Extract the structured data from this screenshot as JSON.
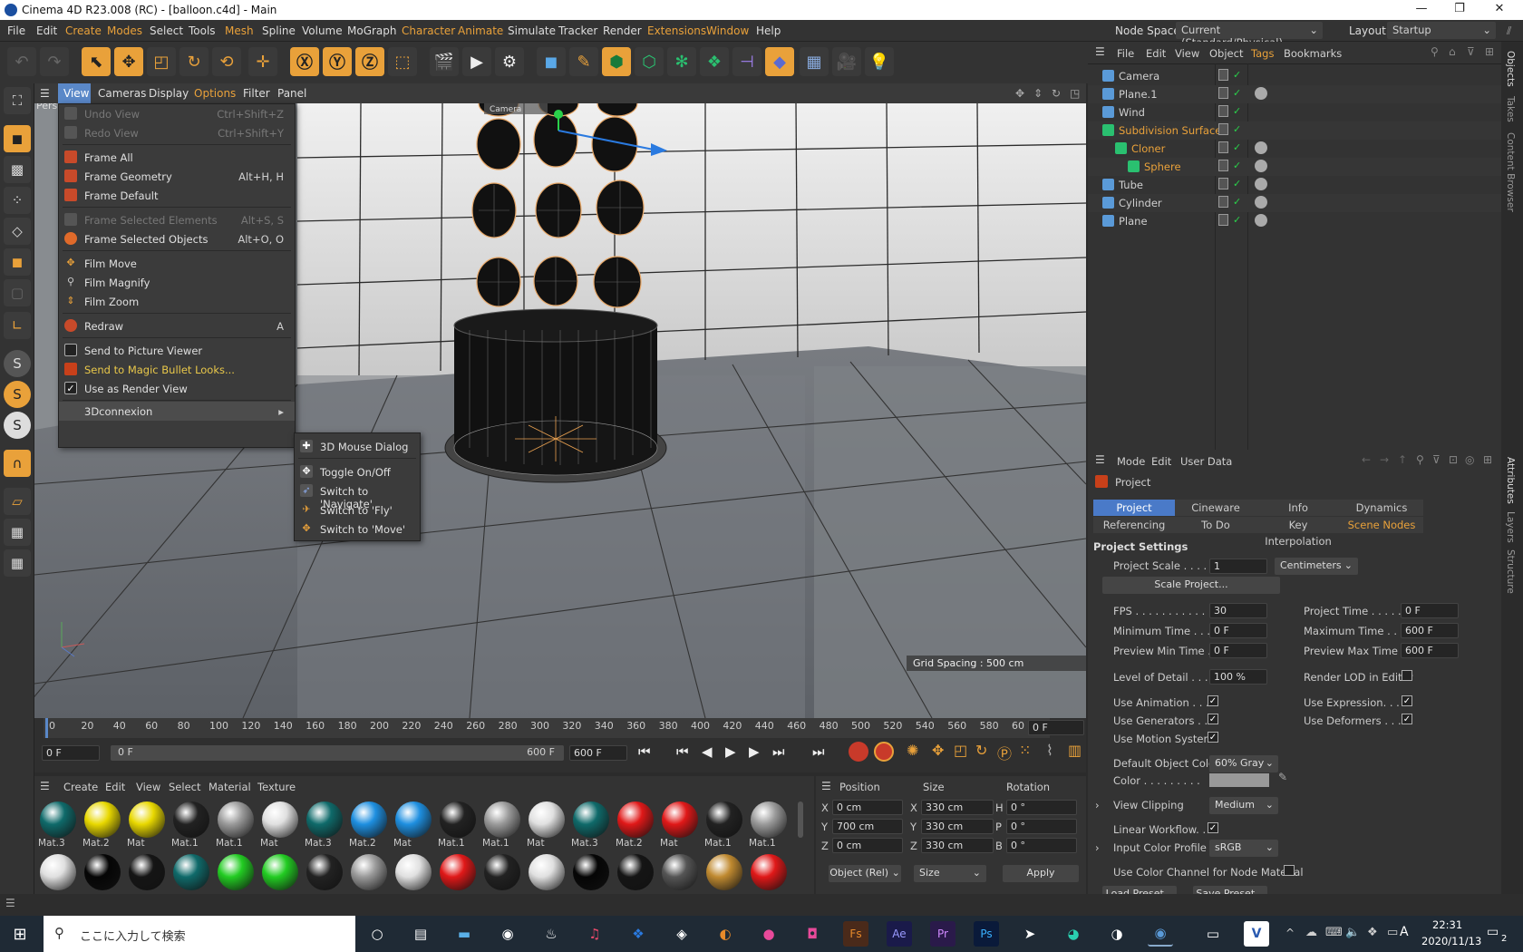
{
  "window": {
    "title": "Cinema 4D R23.008 (RC) - [balloon.c4d] - Main",
    "minimize": "—",
    "maximize": "❐",
    "close": "✕"
  },
  "menubar": {
    "items": [
      "File",
      "Edit",
      "Create",
      "Modes",
      "Select",
      "Tools",
      "Mesh",
      "Spline",
      "Volume",
      "MoGraph",
      "Character",
      "Animate",
      "Simulate",
      "Tracker",
      "Render",
      "Extensions",
      "Window",
      "Help"
    ],
    "nodespace_label": "Node Space:",
    "nodespace_value": "Current (Standard/Physical)",
    "layout_label": "Layout:",
    "layout_value": "Startup"
  },
  "viewport_menu": {
    "items": [
      "View",
      "Cameras",
      "Display",
      "Options",
      "Filter",
      "Panel"
    ],
    "persp": "Pers",
    "grid_spacing": "Grid Spacing : 500 cm",
    "camera_tag": "Camera"
  },
  "view_menu": {
    "undo_view": "Undo View",
    "undo_view_sc": "Ctrl+Shift+Z",
    "redo_view": "Redo View",
    "redo_view_sc": "Ctrl+Shift+Y",
    "frame_all": "Frame All",
    "frame_geometry": "Frame Geometry",
    "frame_geometry_sc": "Alt+H, H",
    "frame_default": "Frame Default",
    "frame_selected_elements": "Frame Selected Elements",
    "frame_selected_elements_sc": "Alt+S, S",
    "frame_selected_objects": "Frame Selected Objects",
    "frame_selected_objects_sc": "Alt+O, O",
    "film_move": "Film Move",
    "film_magnify": "Film Magnify",
    "film_zoom": "Film Zoom",
    "redraw": "Redraw",
    "redraw_sc": "A",
    "send_picture_viewer": "Send to Picture Viewer",
    "send_magic_bullet": "Send to Magic Bullet Looks...",
    "use_render_view": "Use as Render View",
    "connexion": "3Dconnexion"
  },
  "submenu": {
    "mouse_dialog": "3D Mouse Dialog",
    "toggle": "Toggle On/Off",
    "navigate": "Switch to 'Navigate'",
    "fly": "Switch to 'Fly'",
    "move": "Switch to 'Move'"
  },
  "timeline": {
    "ticks": [
      "0",
      "20",
      "40",
      "60",
      "80",
      "100",
      "120",
      "140",
      "160",
      "180",
      "200",
      "220",
      "240",
      "260",
      "280",
      "300",
      "320",
      "340",
      "360",
      "380",
      "400",
      "420",
      "440",
      "460",
      "480",
      "500",
      "520",
      "540",
      "560",
      "580",
      "60"
    ],
    "current_frame": "0 F",
    "start": "0 F",
    "range_start": "0 F",
    "range_end": "600 F",
    "end": "600 F",
    "right_frame": "0 F"
  },
  "material_manager": {
    "menu": [
      "Create",
      "Edit",
      "View",
      "Select",
      "Material",
      "Texture"
    ],
    "row1": [
      {
        "name": "Mat.3",
        "color": "#0f6a6a"
      },
      {
        "name": "Mat.2",
        "color": "#e8d800"
      },
      {
        "name": "Mat",
        "color": "#e8d800"
      },
      {
        "name": "Mat.1",
        "color": "#222222"
      },
      {
        "name": "Mat.1",
        "color": "#9a9a9a"
      },
      {
        "name": "Mat",
        "color": "#e0e0e0"
      },
      {
        "name": "Mat.3",
        "color": "#0f6a6a"
      },
      {
        "name": "Mat.2",
        "color": "#1e8fe0"
      },
      {
        "name": "Mat",
        "color": "#1e8fe0"
      },
      {
        "name": "Mat.1",
        "color": "#222222"
      },
      {
        "name": "Mat.1",
        "color": "#9a9a9a"
      },
      {
        "name": "Mat",
        "color": "#e0e0e0"
      },
      {
        "name": "Mat.3",
        "color": "#0f6a6a"
      },
      {
        "name": "Mat.2",
        "color": "#e01818"
      },
      {
        "name": "Mat",
        "color": "#e01818"
      },
      {
        "name": "Mat.1",
        "color": "#222222"
      },
      {
        "name": "Mat.1",
        "color": "#9a9a9a"
      }
    ],
    "row2": [
      "#e0e0e0",
      "#050505",
      "#151515",
      "#0f6a6a",
      "#22cc22",
      "#22cc22",
      "#222222",
      "#9a9a9a",
      "#e0e0e0",
      "#e01818",
      "#222222",
      "#e0e0e0",
      "#050505",
      "#151515",
      "#555555",
      "#c08a30",
      "#e01818"
    ]
  },
  "coord_manager": {
    "headers": {
      "position": "Position",
      "size": "Size",
      "rotation": "Rotation"
    },
    "rows": [
      {
        "axis": "X",
        "pos": "0 cm",
        "saxis": "X",
        "size": "330 cm",
        "raxis": "H",
        "rot": "0 °"
      },
      {
        "axis": "Y",
        "pos": "700 cm",
        "saxis": "Y",
        "size": "330 cm",
        "raxis": "P",
        "rot": "0 °"
      },
      {
        "axis": "Z",
        "pos": "0 cm",
        "saxis": "Z",
        "size": "330 cm",
        "raxis": "B",
        "rot": "0 °"
      }
    ],
    "mode": "Object (Rel)",
    "size_mode": "Size",
    "apply": "Apply"
  },
  "object_manager": {
    "menu": [
      "File",
      "Edit",
      "View",
      "Object",
      "Tags",
      "Bookmarks"
    ],
    "objects": [
      {
        "name": "Camera",
        "indent": 0,
        "color": "#d0d0d0",
        "icon": "camera-icon"
      },
      {
        "name": "Plane.1",
        "indent": 0,
        "color": "#d0d0d0",
        "icon": "plane-icon"
      },
      {
        "name": "Wind",
        "indent": 0,
        "color": "#d0d0d0",
        "icon": "wind-icon"
      },
      {
        "name": "Subdivision Surface",
        "indent": 0,
        "color": "#e9a13a",
        "icon": "subdivision-icon"
      },
      {
        "name": "Cloner",
        "indent": 1,
        "color": "#e9a13a",
        "icon": "cloner-icon"
      },
      {
        "name": "Sphere",
        "indent": 2,
        "color": "#e9a13a",
        "icon": "sphere-icon"
      },
      {
        "name": "Tube",
        "indent": 0,
        "color": "#d0d0d0",
        "icon": "tube-icon"
      },
      {
        "name": "Cylinder",
        "indent": 0,
        "color": "#d0d0d0",
        "icon": "cylinder-icon"
      },
      {
        "name": "Plane",
        "indent": 0,
        "color": "#d0d0d0",
        "icon": "plane-icon"
      }
    ]
  },
  "attributes": {
    "menu": [
      "Mode",
      "Edit",
      "User Data"
    ],
    "title": "Project",
    "tabs_row1": [
      "Project Settings",
      "Cineware",
      "Info",
      "Dynamics"
    ],
    "tabs_row2": [
      "Referencing",
      "To Do",
      "Key Interpolation",
      "Scene Nodes"
    ],
    "section": "Project Settings",
    "project_scale_label": "Project Scale . . . . .",
    "project_scale": "1",
    "project_scale_unit": "Centimeters",
    "scale_project": "Scale Project...",
    "fps_label": "FPS . . . . . . . . . . . .",
    "fps": "30",
    "project_time_label": "Project Time . . . . .",
    "project_time": "0 F",
    "min_time_label": "Minimum Time . . .",
    "min_time": "0 F",
    "max_time_label": "Maximum Time . .",
    "max_time": "600 F",
    "prev_min_label": "Preview Min Time .",
    "prev_min": "0 F",
    "prev_max_label": "Preview Max Time .",
    "prev_max": "600 F",
    "lod_label": "Level of Detail . . . .",
    "lod": "100 %",
    "render_lod_label": "Render LOD in Editor",
    "use_animation": "Use Animation . . . .",
    "use_expression": "Use Expression. . . .",
    "use_generators": "Use Generators . . .",
    "use_deformers": "Use Deformers . . . .",
    "use_motion": "Use Motion System",
    "default_color_label": "Default Object Color",
    "default_color": "60% Gray",
    "color_label": "Color . . . . . . . . .",
    "view_clipping_label": "View Clipping",
    "view_clipping": "Medium",
    "linear_workflow": "Linear Workflow. . .",
    "input_profile_label": "Input Color Profile",
    "input_profile": "sRGB",
    "use_color_channel": "Use Color Channel for Node Material",
    "load_preset": "Load Preset...",
    "save_preset": "Save Preset..."
  },
  "side_tabs": [
    "Objects",
    "Takes",
    "Content Browser",
    "Attributes",
    "Layers",
    "Structure"
  ],
  "taskbar": {
    "search": "ここに入力して検索",
    "time": "22:31",
    "date": "2020/11/13",
    "ime": "A",
    "notif": "2"
  }
}
